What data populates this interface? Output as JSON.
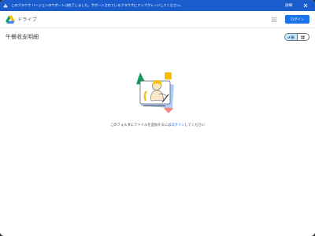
{
  "banner": {
    "message": "このブラウザ バージョンのサポートは終了しました。サポートされているブラウザにアップグレードしてください。",
    "detail_label": "詳細",
    "warning_icon": "warning-icon",
    "close_icon": "close-icon"
  },
  "header": {
    "app_name": "ドライブ",
    "logo_icon": "google-drive-logo",
    "apps_icon": "apps-grid-icon",
    "login_label": "ログイン"
  },
  "folder": {
    "title": "午餐收支明細",
    "view_list_icon": "list-view-icon",
    "view_grid_icon": "grid-view-icon"
  },
  "empty_state": {
    "illustration": "empty-folder-illustration",
    "message_prefix": "このフォルダにファイルを追加するには",
    "message_link": "ログイン",
    "message_suffix": "してください"
  },
  "colors": {
    "banner_bg": "#1a5ccd",
    "accent": "#1a73e8",
    "toggle_active": "#c2e7ff"
  }
}
